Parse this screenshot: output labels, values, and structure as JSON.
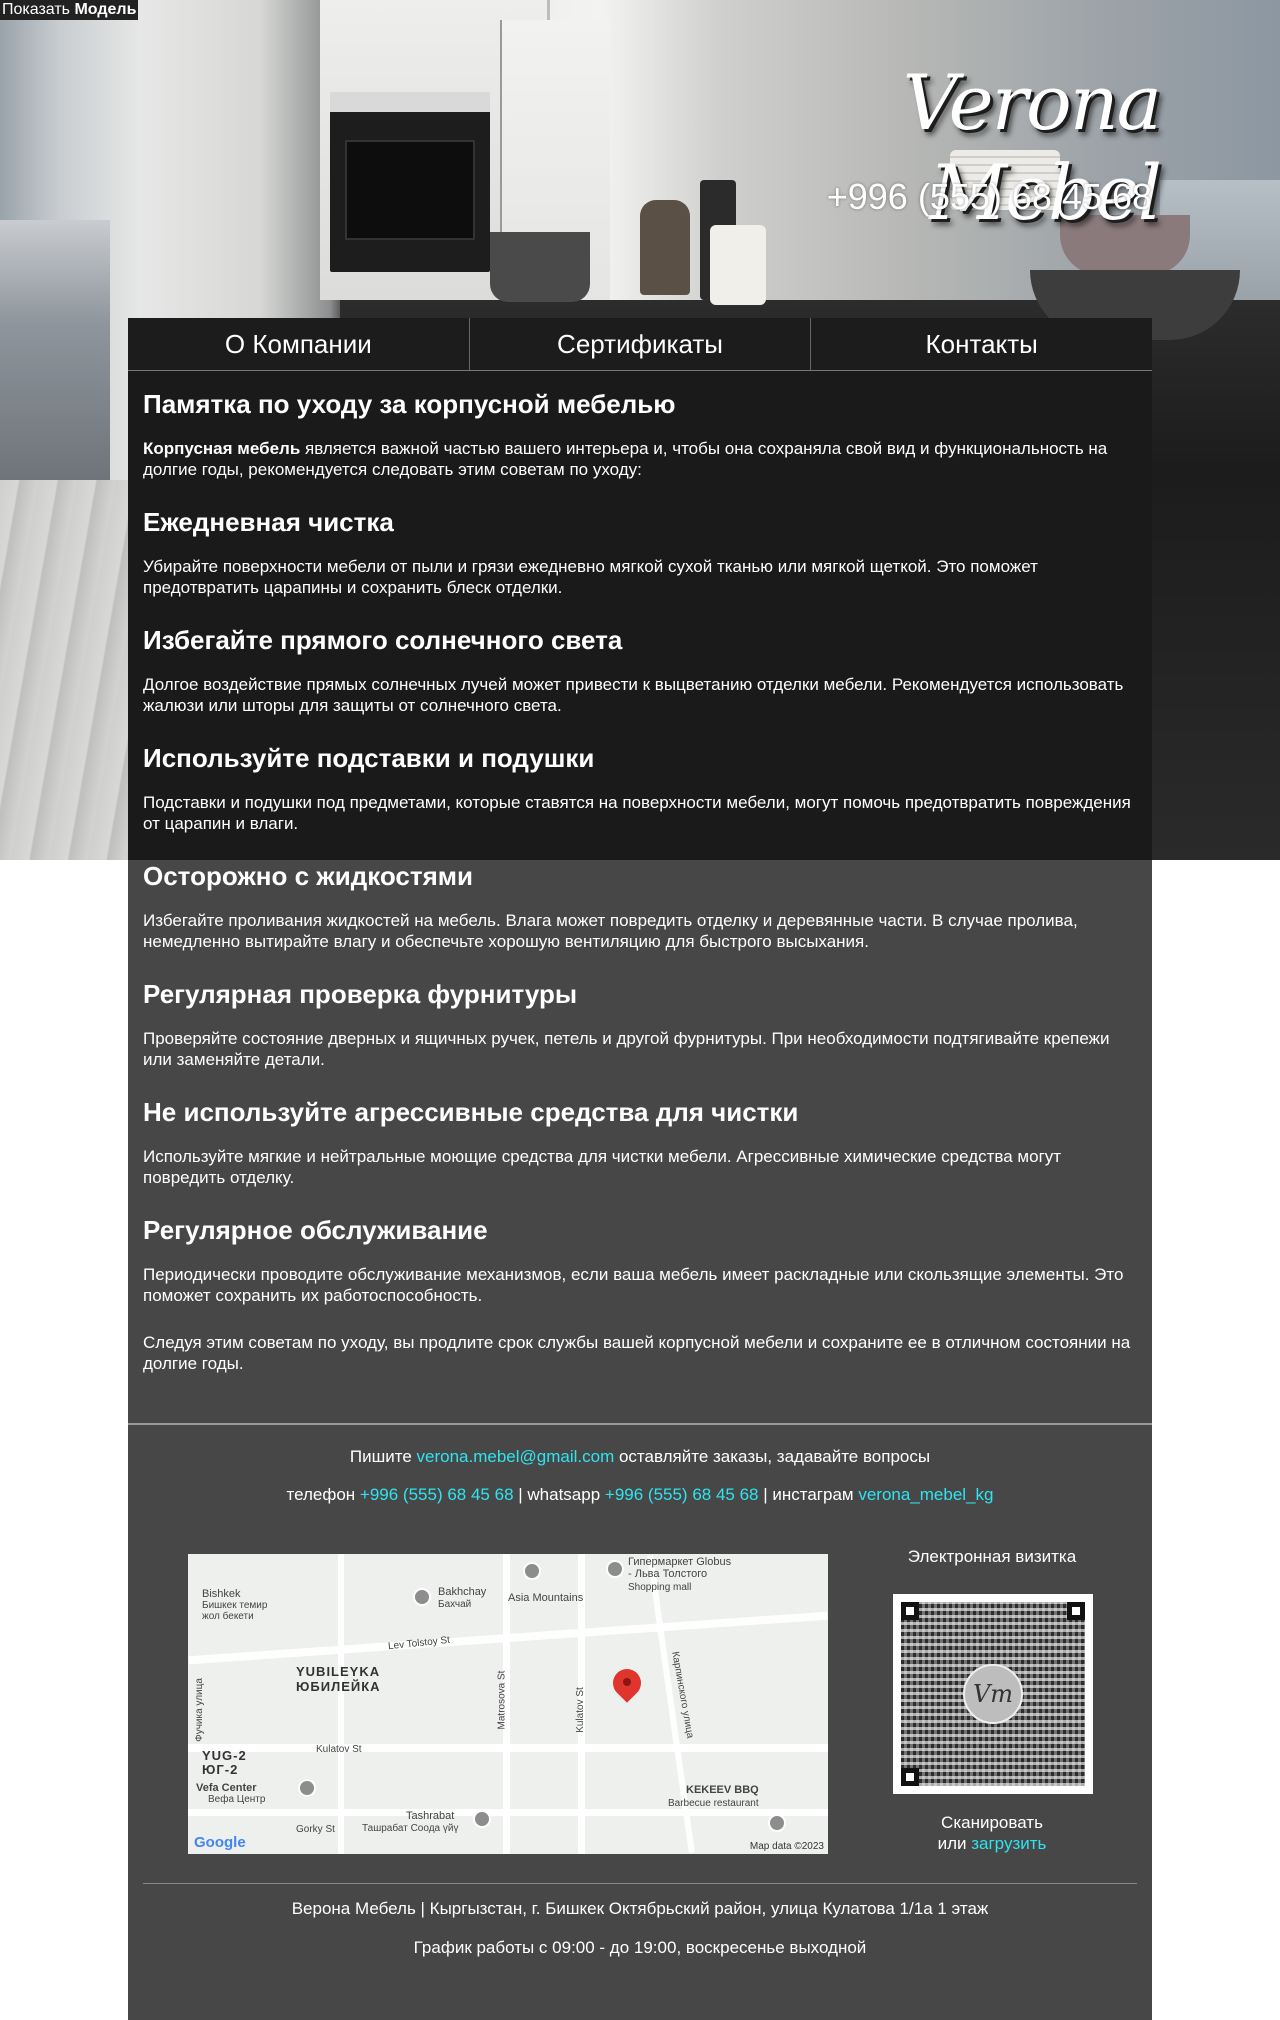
{
  "top_label": {
    "prefix": "Показать",
    "bold": "Модель"
  },
  "header": {
    "logo_text": "Verona Mebel",
    "phone": "+996 (555) 68 45 68"
  },
  "nav": [
    {
      "label": "О Компании"
    },
    {
      "label": "Сертификаты"
    },
    {
      "label": "Контакты"
    }
  ],
  "article": {
    "title": "Памятка по уходу за корпусной мебелью",
    "intro_bold": "Корпусная мебель",
    "intro_rest": " является важной частью вашего интерьера и, чтобы она сохраняла свой вид и функциональность на долгие годы, рекомендуется следовать этим советам по уходу:",
    "sections": [
      {
        "heading": "Ежедневная чистка",
        "text": "Убирайте поверхности мебели от пыли и грязи ежедневно мягкой сухой тканью или мягкой щеткой. Это поможет предотвратить царапины и сохранить блеск отделки."
      },
      {
        "heading": "Избегайте прямого солнечного света",
        "text": "Долгое воздействие прямых солнечных лучей может привести к выцветанию отделки мебели. Рекомендуется использовать жалюзи или шторы для защиты от солнечного света."
      },
      {
        "heading": "Используйте подставки и подушки",
        "text": "Подставки и подушки под предметами, которые ставятся на поверхности мебели, могут помочь предотвратить повреждения от царапин и влаги."
      },
      {
        "heading": "Осторожно с жидкостями",
        "text": "Избегайте проливания жидкостей на мебель. Влага может повредить отделку и деревянные части. В случае пролива, немедленно вытирайте влагу и обеспечьте хорошую вентиляцию для быстрого высыхания."
      },
      {
        "heading": "Регулярная проверка фурнитуры",
        "text": "Проверяйте состояние дверных и ящичных ручек, петель и другой фурнитуры. При необходимости подтягивайте крепежи или заменяйте детали."
      },
      {
        "heading": "Не используйте агрессивные средства для чистки",
        "text": "Используйте мягкие и нейтральные моющие средства для чистки мебели. Агрессивные химические средства могут повредить отделку."
      },
      {
        "heading": "Регулярное обслуживание",
        "text": "Периодически проводите обслуживание механизмов, если ваша мебель имеет раскладные или скользящие элементы. Это поможет сохранить их работоспособность."
      }
    ],
    "closing": "Следуя этим советам по уходу, вы продлите срок службы вашей корпусной мебели и сохраните ее в отличном состоянии на долгие годы."
  },
  "footer": {
    "write_prefix": "Пишите ",
    "email": "verona.mebel@gmail.com",
    "write_suffix": " оставляйте заказы, задавайте вопросы",
    "phone_label": "телефон ",
    "phone": "+996 (555) 68 45 68",
    "sep1": " |  whatsapp ",
    "whatsapp": "+996 (555) 68 45 68",
    "sep2": " |  инстаграм ",
    "instagram": "verona_mebel_kg",
    "vcard_title": "Электронная визитка",
    "qr_logo": "Vm",
    "scan_line1": "Сканировать",
    "scan_or": "или ",
    "scan_link": "загрузить",
    "address": "Верона Мебель | Кыргызстан, г. Бишкек Октябрьский район, улица Кулатова 1/1а 1 этаж",
    "hours": "График работы с 09:00 - до 19:00, воскресенье выходной"
  },
  "map": {
    "labels": {
      "globus": "Гипермаркет Globus",
      "globus2": "- Льва Толстого",
      "shopping": "Shopping mall",
      "bishkek": "Bishkek",
      "bishkek_ru1": "Бишкек темир",
      "bishkek_ru2": "жол бекети",
      "bakhchay": "Bakhchay",
      "bakhchay_ru": "Бахчай",
      "asia": "Asia Mountains",
      "tolstoy": "Lev Tolstoy St",
      "yubileyka": "YUBILEYKA",
      "yubileyka_ru": "ЮБИЛЕЙКА",
      "matrosova": "Matrosova St",
      "kulatov_st_v": "Kulatov St",
      "kulatov_st_h": "Kulatov St",
      "karpinka": "Карпинского улица",
      "yug2": "YUG-2",
      "yug2_ru": "ЮГ-2",
      "vefa": "Vefa Center",
      "vefa_ru": "Вефа Центр",
      "fuchika": "Фучика улица",
      "kekeev": "KEKEEV BBQ",
      "barbecue": "Barbecue restaurant",
      "tashrabat": "Tashrabat",
      "tashrabat_ru": "Ташрабат Соода үйү",
      "gorky": "Gorky St",
      "google": "Google",
      "attrib": "Map data ©2023"
    }
  },
  "colors": {
    "column_bg": "#474747",
    "link": "#2fe4f0"
  }
}
